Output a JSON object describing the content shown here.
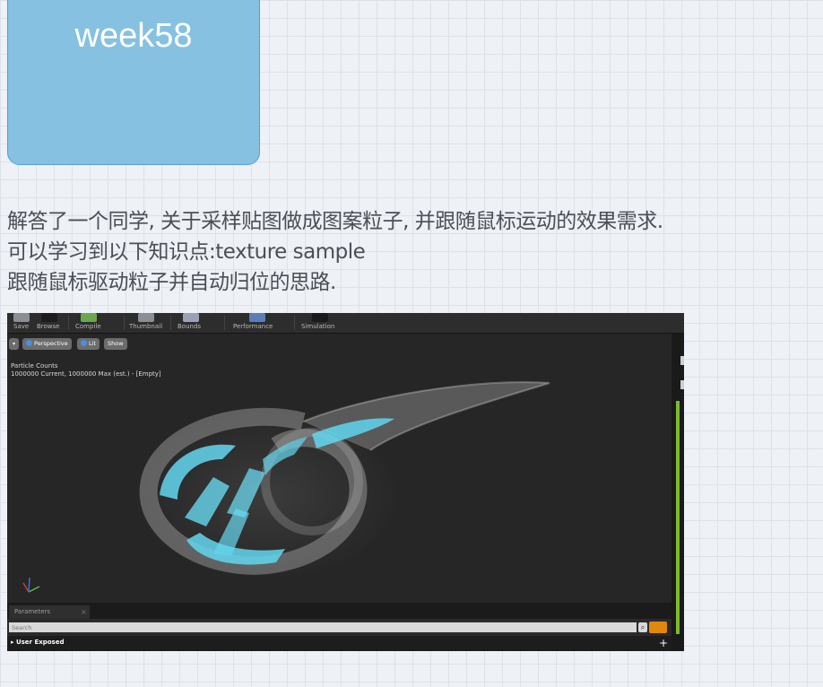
{
  "card": {
    "title": "week58"
  },
  "description": {
    "lines": [
      "解答了一个同学, 关于采样贴图做成图案粒子, 并跟随鼠标运动的效果需求.",
      "可以学习到以下知识点:texture sample",
      "跟随鼠标驱动粒子并自动归位的思路."
    ]
  },
  "screenshot": {
    "toolbar": {
      "save": "Save",
      "browse": "Browse",
      "compile": "Compile",
      "thumbnail": "Thumbnail",
      "bounds": "Bounds",
      "performance": "Performance",
      "simulation": "Simulation"
    },
    "viewport": {
      "perspective_label": "Perspective",
      "lit_label": "Lit",
      "show_label": "Show",
      "particle_counts_title": "Particle Counts",
      "particle_counts_value": "1000000 Current, 1000000 Max (est.) - [Empty]"
    },
    "params": {
      "tab_label": "Parameters",
      "search_placeholder": "Search",
      "user_exposed_label": "User Exposed"
    },
    "colors": {
      "particle_cyan": "#5fd6ee",
      "particle_white": "#d8d8d8",
      "accent_orange": "#e0870f",
      "accent_green": "#7dbb2a"
    }
  }
}
